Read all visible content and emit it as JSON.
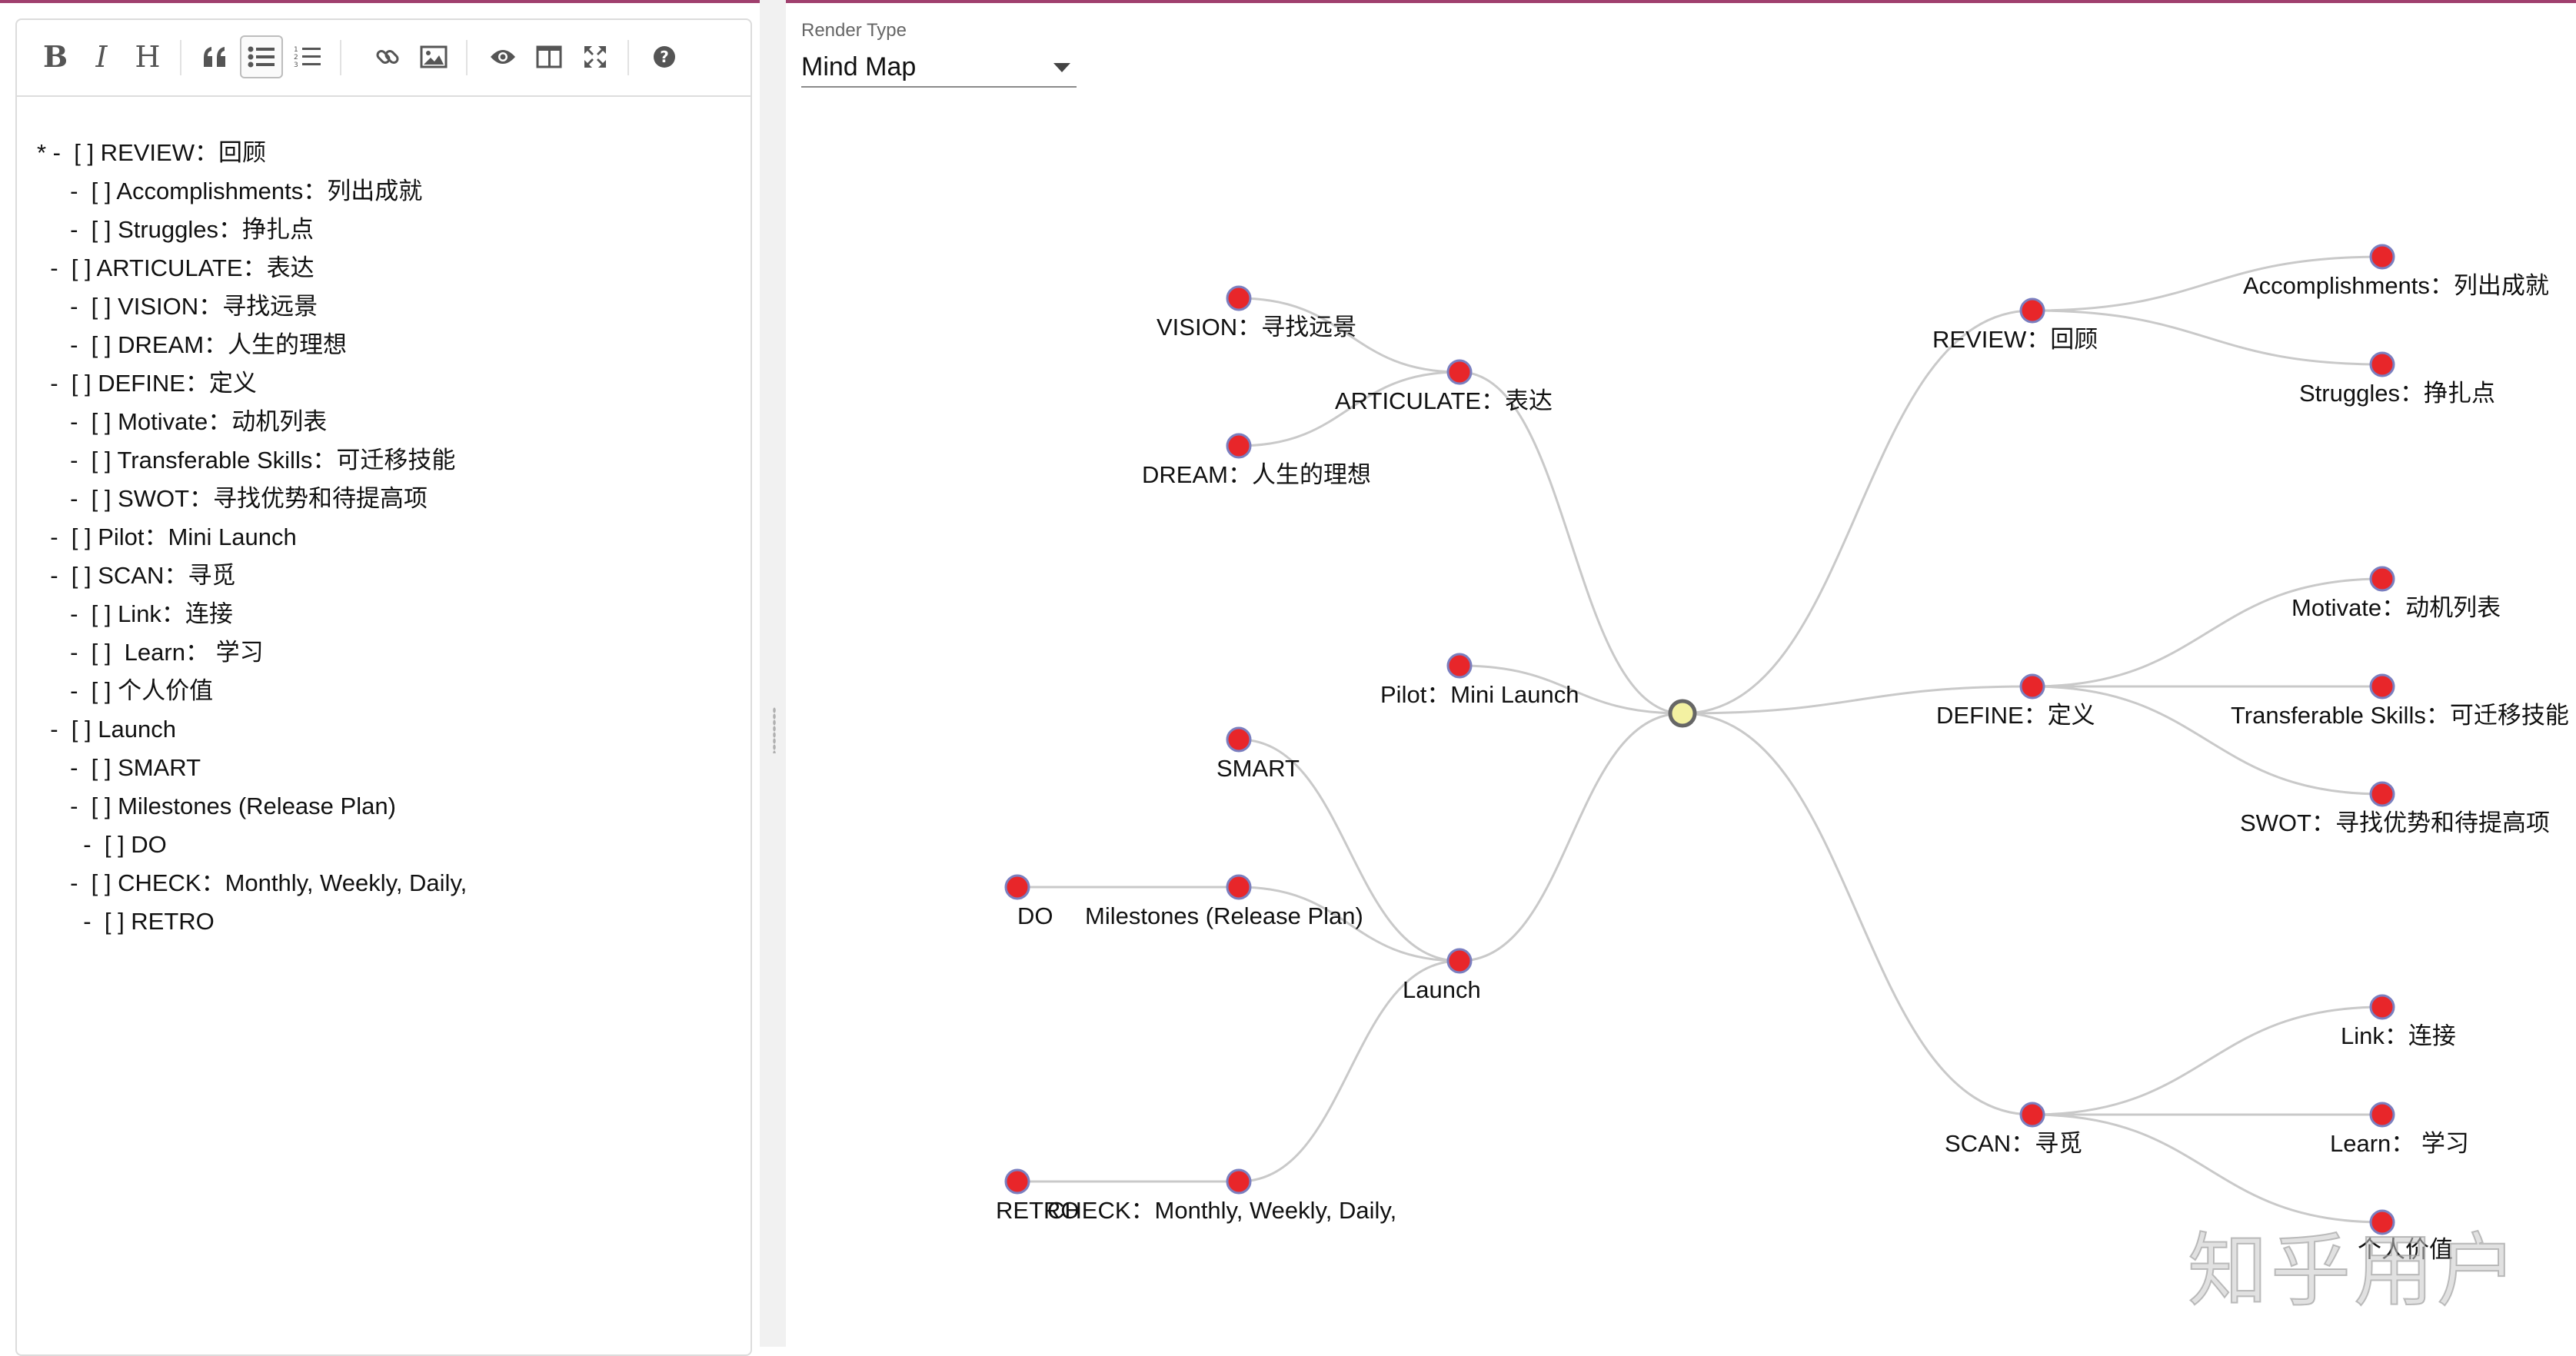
{
  "toolbar": {
    "bold": "B",
    "italic": "I",
    "heading": "H"
  },
  "editor": {
    "lines": [
      "* -  [ ] REVIEW：回顾",
      "     -  [ ] Accomplishments：列出成就",
      "     -  [ ] Struggles：挣扎点",
      "  -  [ ] ARTICULATE：表达",
      "     -  [ ] VISION：寻找远景",
      "     -  [ ] DREAM：人生的理想",
      "  -  [ ] DEFINE：定义",
      "     -  [ ] Motivate：动机列表",
      "     -  [ ] Transferable Skills：可迁移技能",
      "     -  [ ] SWOT：寻找优势和待提高项",
      "  -  [ ] Pilot：Mini Launch",
      "  -  [ ] SCAN：寻觅",
      "     -  [ ] Link：连接",
      "     -  [ ]  Learn： 学习",
      "     -  [ ] 个人价值",
      "  -  [ ] Launch",
      "     -  [ ] SMART",
      "     -  [ ] Milestones (Release Plan)",
      "       -  [ ] DO",
      "     -  [ ] CHECK：Monthly, Weekly, Daily,",
      "       -  [ ] RETRO"
    ]
  },
  "render_type": {
    "label": "Render Type",
    "value": "Mind Map"
  },
  "mindmap": {
    "colors": {
      "node": "#e8262a",
      "node_stroke": "#7a7fc0",
      "root_fill": "#f3f1a2",
      "root_stroke": "#666666",
      "link": "#c9c9c9"
    },
    "labels": {
      "review": "REVIEW：回顾",
      "accomplishments": "Accomplishments：列出成就",
      "struggles": "Struggles：挣扎点",
      "articulate": "ARTICULATE：表达",
      "vision": "VISION：寻找远景",
      "dream": "DREAM：人生的理想",
      "define": "DEFINE：定义",
      "motivate": "Motivate：动机列表",
      "transferable": "Transferable Skills：可迁移技能",
      "swot": "SWOT：寻找优势和待提高项",
      "pilot": "Pilot：Mini Launch",
      "scan": "SCAN：寻觅",
      "link": "Link：连接",
      "learn": "Learn： 学习",
      "value": "个人价值",
      "launch": "Launch",
      "smart": "SMART",
      "milestones": "Milestones (Release Plan)",
      "do": "DO",
      "check": "CHECK：Monthly, Weekly, Daily,",
      "retro": "RETRO"
    }
  },
  "watermark": "知乎用户"
}
